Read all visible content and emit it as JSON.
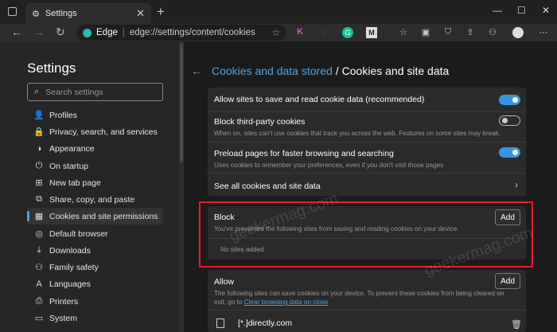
{
  "browser": {
    "tab_title": "Settings",
    "new_tab": "+",
    "address_brand": "Edge",
    "address_url": "edge://settings/content/cookies",
    "window_controls": [
      "—",
      "☐",
      "✕"
    ]
  },
  "sidebar": {
    "title": "Settings",
    "search_placeholder": "Search settings",
    "items": [
      {
        "label": "Profiles",
        "icon": "profile-icon"
      },
      {
        "label": "Privacy, search, and services",
        "icon": "lock-icon"
      },
      {
        "label": "Appearance",
        "icon": "appearance-icon"
      },
      {
        "label": "On startup",
        "icon": "power-icon"
      },
      {
        "label": "New tab page",
        "icon": "new-tab-icon"
      },
      {
        "label": "Share, copy, and paste",
        "icon": "share-icon"
      },
      {
        "label": "Cookies and site permissions",
        "icon": "cookies-icon"
      },
      {
        "label": "Default browser",
        "icon": "browser-icon"
      },
      {
        "label": "Downloads",
        "icon": "download-icon"
      },
      {
        "label": "Family safety",
        "icon": "family-icon"
      },
      {
        "label": "Languages",
        "icon": "language-icon"
      },
      {
        "label": "Printers",
        "icon": "printer-icon"
      },
      {
        "label": "System",
        "icon": "system-icon"
      }
    ]
  },
  "header": {
    "breadcrumb": "Cookies and data stored",
    "separator": "/",
    "title": "Cookies and site data"
  },
  "settings": {
    "allow_save": {
      "title": "Allow sites to save and read cookie data (recommended)",
      "enabled": true
    },
    "block_third_party": {
      "title": "Block third-party cookies",
      "desc": "When on, sites can't use cookies that track you across the web. Features on some sites may break.",
      "enabled": false
    },
    "preload": {
      "title": "Preload pages for faster browsing and searching",
      "desc": "Uses cookies to remember your preferences, even if you don't visit those pages",
      "enabled": true
    },
    "see_all": {
      "title": "See all cookies and site data"
    }
  },
  "block": {
    "title": "Block",
    "desc": "You've prevented the following sites from saving and reading cookies on your device.",
    "empty": "No sites added",
    "add_label": "Add"
  },
  "allow": {
    "title": "Allow",
    "desc_part1": "The following sites can save cookies on your device. To prevent these cookies from being cleared on",
    "desc_part2": "exit, go to",
    "link": "Clear browsing data on close",
    "add_label": "Add",
    "sites": [
      "[*.]directly.com"
    ]
  },
  "watermark": "geekermag.com",
  "colors": {
    "accent": "#4da3e6",
    "toggle_on": "#3b93dd",
    "highlight": "#e0202a"
  }
}
